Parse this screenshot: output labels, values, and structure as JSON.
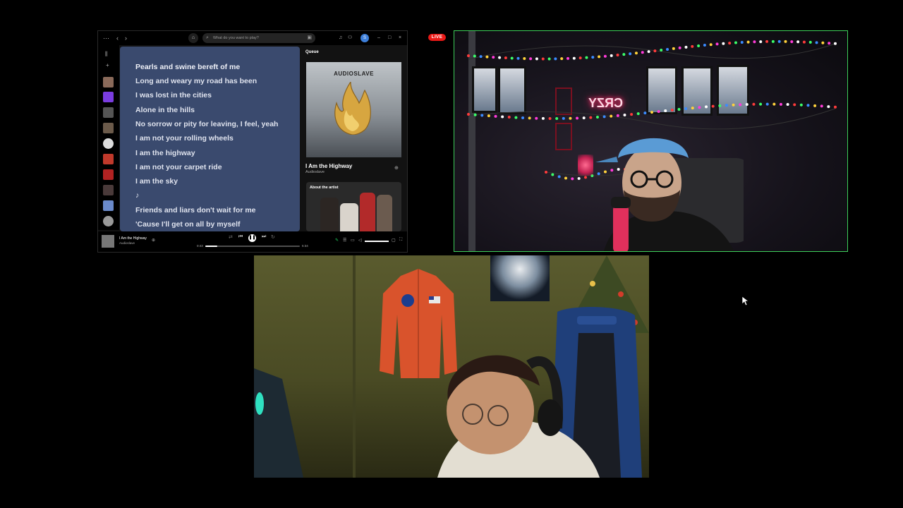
{
  "stream": {
    "live_label": "LIVE"
  },
  "spotify": {
    "search_placeholder": "What do you want to play?",
    "avatar_letter": "S",
    "lyrics": [
      "Pearls and swine bereft of me",
      "Long and weary my road has been",
      "I was lost in the cities",
      "Alone in the hills",
      "No sorrow or pity for leaving, I feel, yeah",
      "I am not your rolling wheels",
      "I am the highway",
      "I am not your carpet ride",
      "I am the sky",
      "♪",
      "Friends and liars don't wait for me",
      "'Cause I'll get on all by myself"
    ],
    "queue": {
      "title": "Queue",
      "album_wordmark": "AUDIOSLAVE",
      "song": "I Am the Highway",
      "artist": "Audioslave",
      "about_label": "About the artist"
    },
    "now_playing": {
      "song": "I Am the Highway",
      "artist": "Audioslave",
      "current_time": "0:43",
      "duration": "5:34",
      "progress": 0.13,
      "volume": 1.0
    }
  },
  "colors": {
    "lyrics_bg": "#3a4a6e",
    "live_red": "#e91916",
    "cam_border": "#3ecf5a"
  }
}
